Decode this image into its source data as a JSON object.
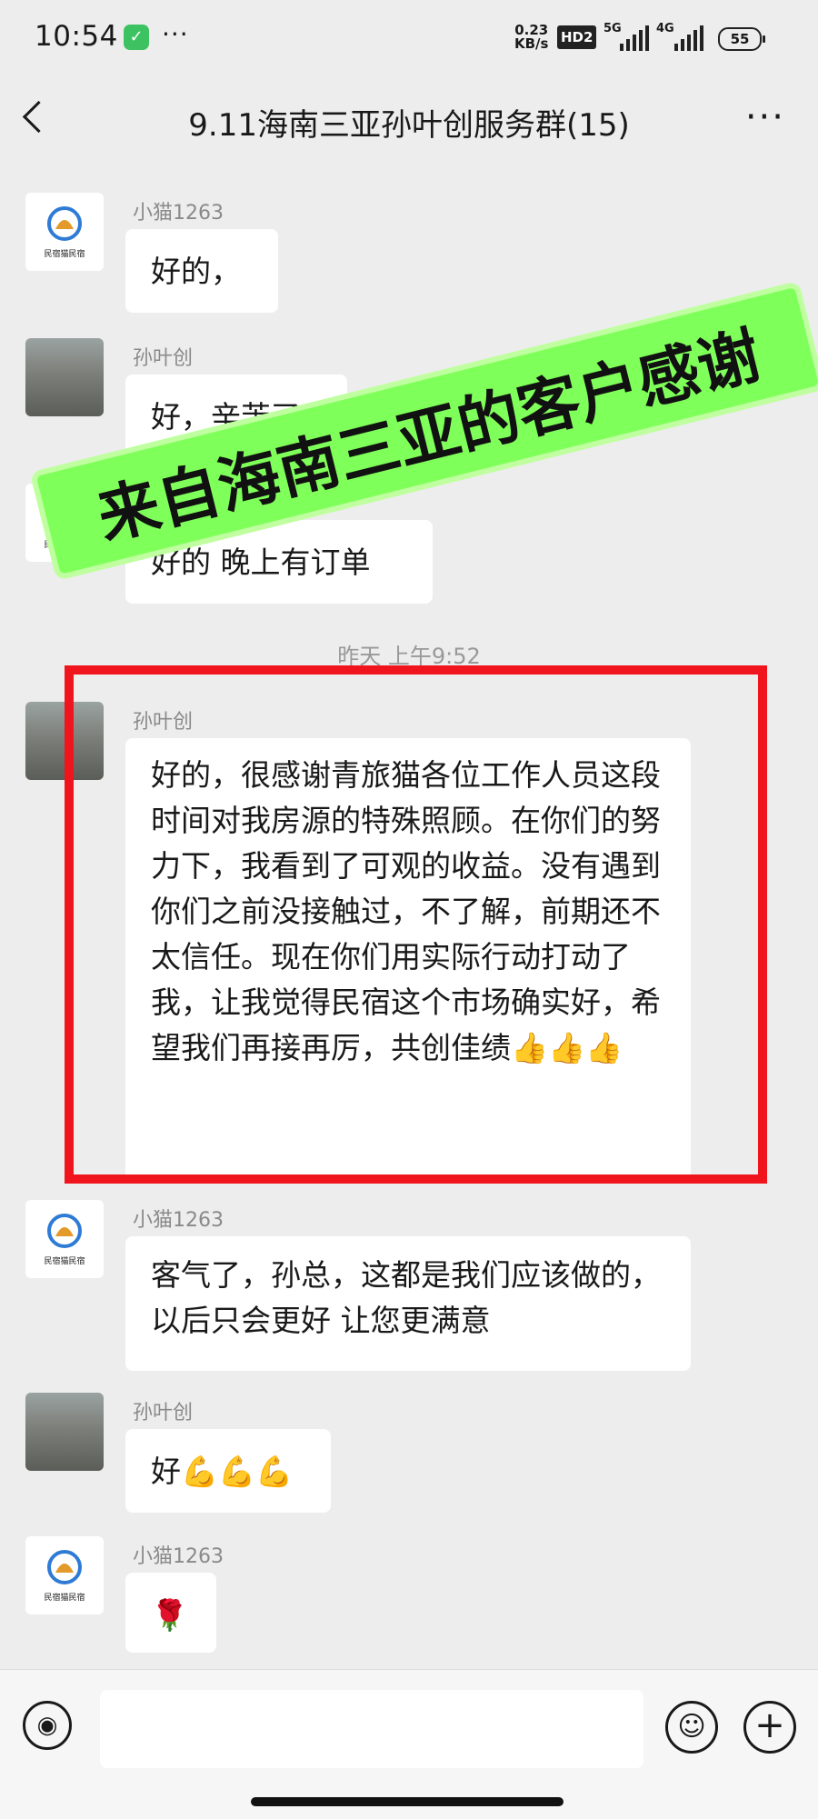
{
  "status": {
    "time": "10:54",
    "app_icon": "shield-check-icon",
    "dots": "···",
    "speed_value": "0.23",
    "speed_unit": "KB/s",
    "hd": "HD2",
    "sig1": "5G",
    "sig2": "4G",
    "battery": "55"
  },
  "header": {
    "title": "9.11海南三亚孙叶创服务群(15)",
    "more": "···"
  },
  "banner": "来自海南三亚的客户感谢",
  "messages": [
    {
      "sender": "小猫1263",
      "text": "好的，",
      "avatar": "minsu-cat-logo"
    },
    {
      "sender": "孙叶创",
      "text": "好，辛苦了",
      "avatar": "user-photo"
    },
    {
      "sender": "小猫1263",
      "text": "好的  晚上有订单",
      "avatar": "minsu-cat-logo"
    },
    {
      "sender": "孙叶创",
      "text": "好的，很感谢青旅猫各位工作人员这段时间对我房源的特殊照顾。在你们的努力下，我看到了可观的收益。没有遇到你们之前没接触过，不了解，前期还不太信任。现在你们用实际行动打动了我，让我觉得民宿这个市场确实好，希望我们再接再厉，共创佳绩👍👍👍",
      "avatar": "user-photo"
    },
    {
      "sender": "小猫1263",
      "text": "客气了，孙总，这都是我们应该做的，以后只会更好 让您更满意",
      "avatar": "minsu-cat-logo"
    },
    {
      "sender": "孙叶创",
      "text": "好💪💪💪",
      "avatar": "user-photo"
    },
    {
      "sender": "小猫1263",
      "text": "🌹",
      "avatar": "minsu-cat-logo"
    }
  ],
  "timestamp": "昨天 上午9:52",
  "logo_text": "民宿猫民宿",
  "colors": {
    "highlight": "#f0141c",
    "banner_bg": "#7fff5a",
    "chat_bg": "#ededed"
  }
}
